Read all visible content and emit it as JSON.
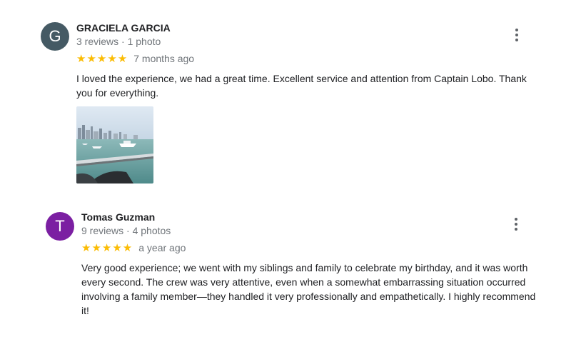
{
  "colors": {
    "star": "#fbbc04",
    "avatar_1": "#455a64",
    "avatar_2": "#7b1fa2",
    "secondary_text": "#70757a"
  },
  "reviews": [
    {
      "avatar_letter": "G",
      "name": "GRACIELA GARCIA",
      "meta": "3 reviews · 1 photo",
      "stars": "★★★★★",
      "rating": 5,
      "time": "7 months ago",
      "text": "I loved the experience, we had a great time. Excellent service and attention from Captain Lobo. Thank you for everything.",
      "photo": "harbor-photo"
    },
    {
      "avatar_letter": "T",
      "name": "Tomas Guzman",
      "meta": "9 reviews · 4 photos",
      "stars": "★★★★★",
      "rating": 5,
      "time": "a year ago",
      "text": "Very good experience; we went with my siblings and family to celebrate my birthday, and it was worth every second. The crew was very attentive, even when a somewhat embarrassing situation occurred involving a family member—they handled it very professionally and empathetically. I highly recommend it!"
    }
  ]
}
